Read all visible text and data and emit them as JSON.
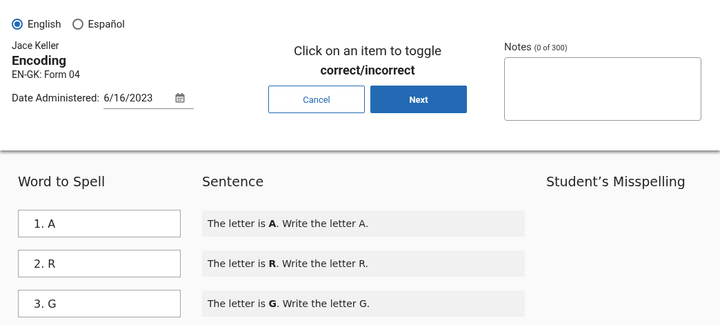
{
  "language_options": [
    {
      "label": "English",
      "selected": true
    },
    {
      "label": "Español",
      "selected": false
    }
  ],
  "student_name": "Jace Keller",
  "assessment_title": "Encoding",
  "form_name": "EN-GK: Form 04",
  "date_field": {
    "label": "Date Administered:",
    "value": "6/16/2023"
  },
  "instruction": {
    "line_1": "Click on an item to toggle",
    "line_2": "correct/incorrect"
  },
  "buttons": [
    {
      "label": "Cancel",
      "kind": "secondary"
    },
    {
      "label": "Next",
      "kind": "primary"
    }
  ],
  "notes": {
    "label": "Notes",
    "counter": "(0 of 300)"
  },
  "table": {
    "columns": [
      "Word to Spell",
      "Sentence",
      "Student’s Misspelling"
    ],
    "rows": [
      {
        "word": "1. A",
        "sentence": "The letter is **A**. Write the letter A."
      },
      {
        "word": "2. R",
        "sentence": "The letter is **R**. Write the letter R."
      },
      {
        "word": "3. G",
        "sentence": "The letter is **G**. Write the letter G."
      }
    ]
  }
}
